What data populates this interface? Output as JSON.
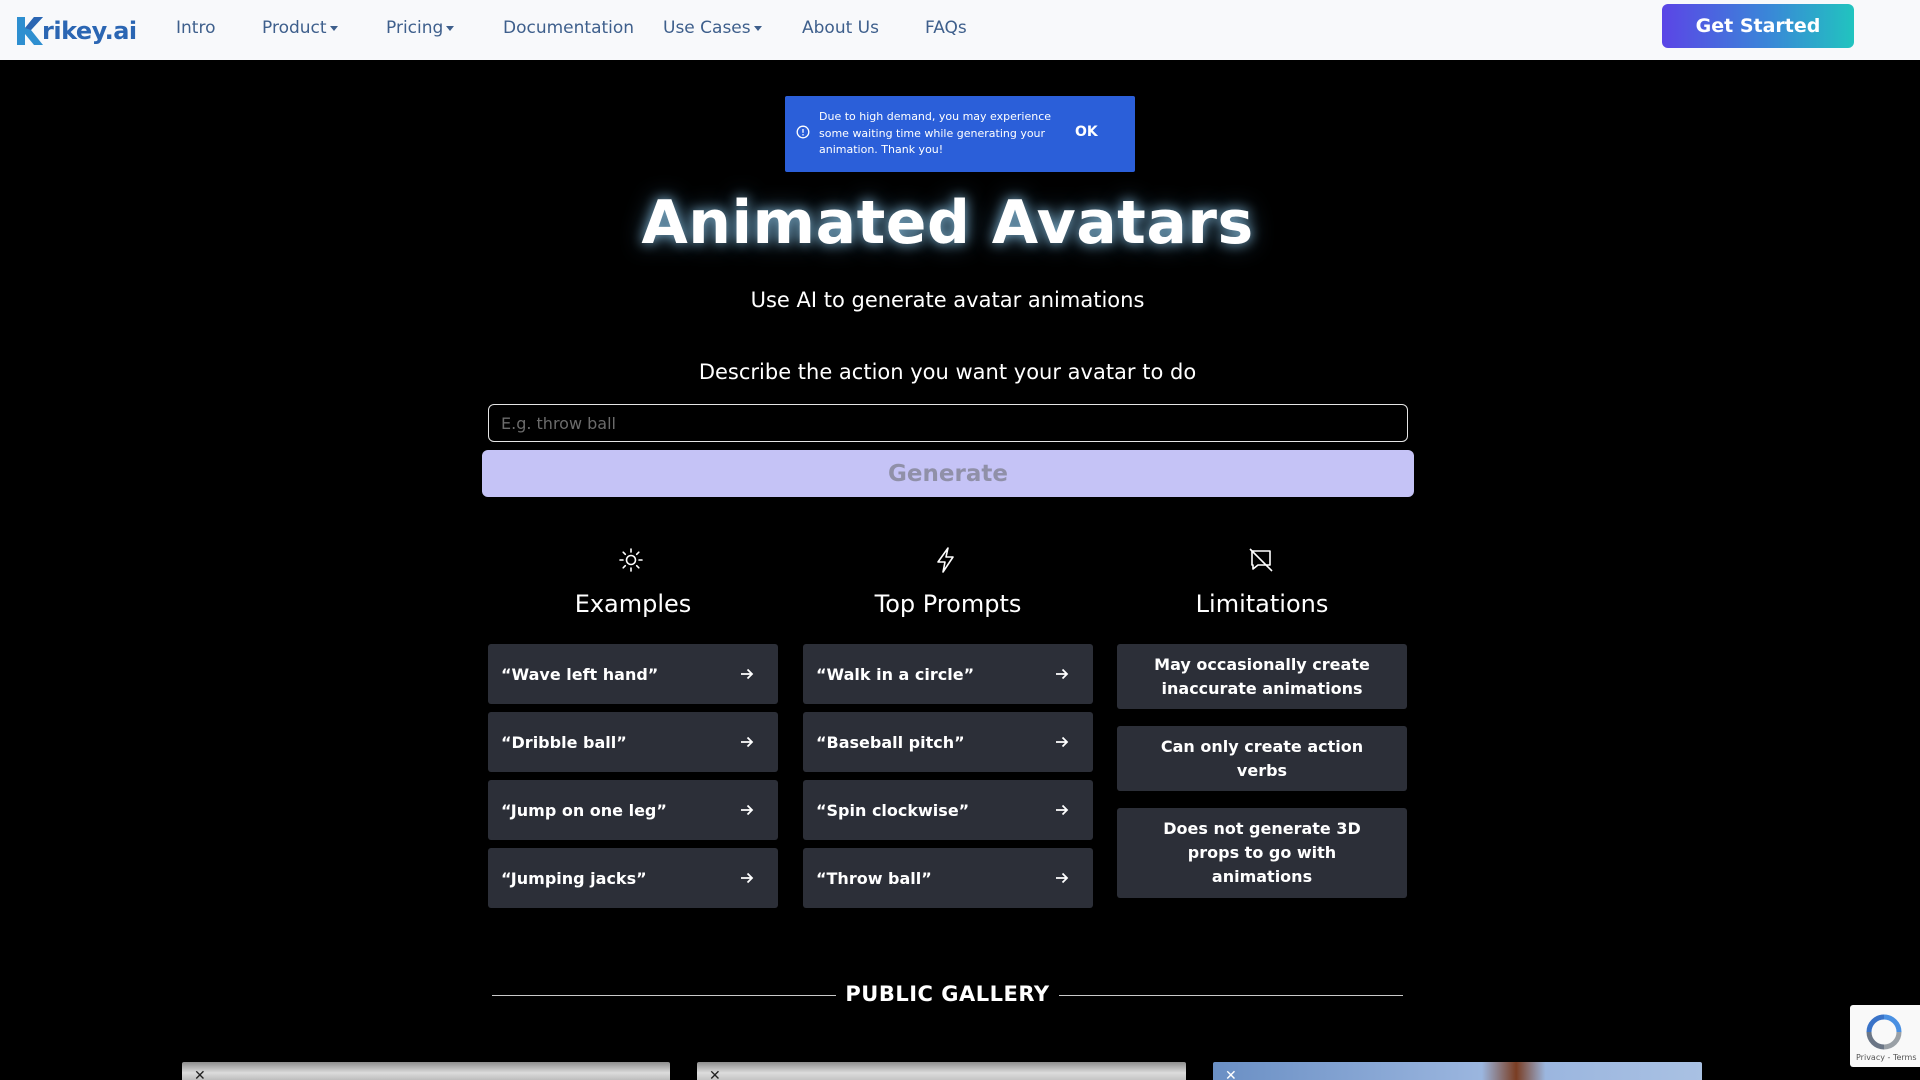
{
  "nav": {
    "logo_text": "rikey.ai",
    "items": [
      {
        "label": "Intro",
        "dropdown": false
      },
      {
        "label": "Product",
        "dropdown": true
      },
      {
        "label": "Pricing",
        "dropdown": true
      },
      {
        "label": "Documentation",
        "dropdown": false
      },
      {
        "label": "Use Cases",
        "dropdown": true
      },
      {
        "label": "About Us",
        "dropdown": false
      },
      {
        "label": "FAQs",
        "dropdown": false
      }
    ],
    "cta_label": "Get Started"
  },
  "alert": {
    "icon": "info-circle-icon",
    "message": "Due to high demand, you may experience some waiting time while generating your animation. Thank you!",
    "ok_label": "OK"
  },
  "hero": {
    "title": "Animated Avatars",
    "subtitle": "Use AI to generate avatar animations",
    "prompt_label": "Describe the action you want your avatar to do",
    "input_placeholder": "E.g. throw ball",
    "input_value": "",
    "generate_label": "Generate"
  },
  "columns": {
    "examples": {
      "icon": "sun-icon",
      "title": "Examples",
      "items": [
        "“Wave left hand”",
        "“Dribble ball”",
        "“Jump on one leg”",
        "“Jumping jacks”"
      ]
    },
    "top_prompts": {
      "icon": "lightning-icon",
      "title": "Top Prompts",
      "items": [
        "“Walk in a circle”",
        "“Baseball pitch”",
        "“Spin clockwise”",
        "“Throw ball”"
      ]
    },
    "limitations": {
      "icon": "message-off-icon",
      "title": "Limitations",
      "items": [
        "May occasionally create inaccurate animations",
        "Can only create action verbs",
        "Does not generate 3D props to go with animations"
      ]
    }
  },
  "gallery": {
    "title": "PUBLIC GALLERY"
  },
  "recaptcha": {
    "terms": "Privacy - Terms"
  },
  "colors": {
    "accent_gradient_start": "#5b45e6",
    "accent_gradient_end": "#21c4bf",
    "alert_bg": "#2b5fd9",
    "generate_bg": "#c5c3f6",
    "card_bg": "#2c2f38",
    "nav_text": "#3e5f8c"
  }
}
